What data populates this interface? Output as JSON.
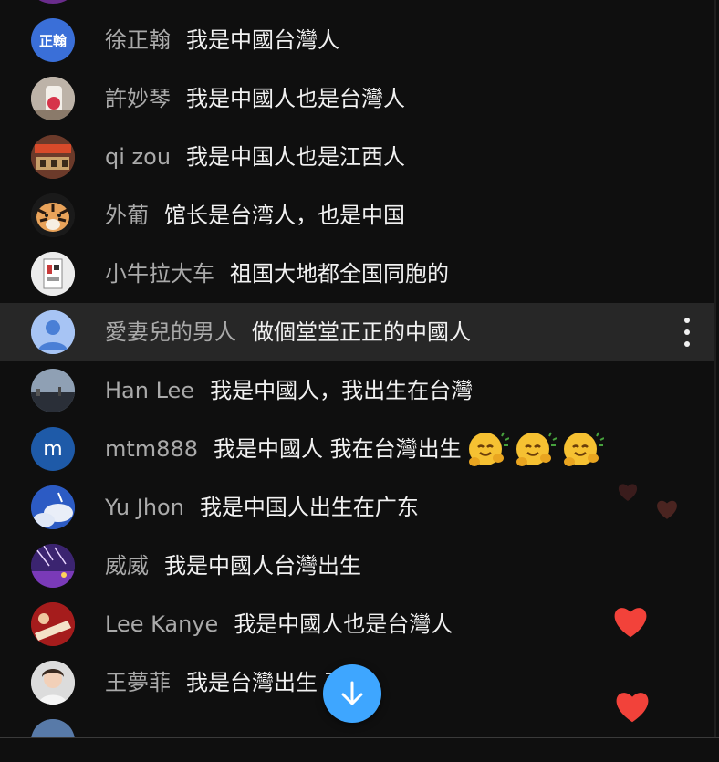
{
  "chat": {
    "messages": [
      {
        "author": "徐正翰",
        "text": "我是中國台灣人",
        "avatar_text": "正翰",
        "avatar_color": "#3a6fd8"
      },
      {
        "author": "許妙琴",
        "text": "我是中國人也是台灣人"
      },
      {
        "author": "qi zou",
        "text": "我是中国人也是江西人"
      },
      {
        "author": "外葡",
        "text": "馆长是台湾人，也是中国"
      },
      {
        "author": "小牛拉大车",
        "text": "祖国大地都全国同胞的"
      },
      {
        "author": "愛妻兒的男人",
        "text": "做個堂堂正正的中國人"
      },
      {
        "author": "Han Lee",
        "text": "我是中國人，我出生在台灣"
      },
      {
        "author": "mtm888",
        "text": "我是中國人 我在台灣出生",
        "avatar_text": "m",
        "avatar_color": "#1e5aa8",
        "emojis": [
          "hugging-face-emoji",
          "hugging-face-emoji",
          "hugging-face-emoji"
        ]
      },
      {
        "author": "Yu Jhon",
        "text": "我是中国人出生在广东"
      },
      {
        "author": "威威",
        "text": "我是中國人台灣出生"
      },
      {
        "author": "Lee Kanye",
        "text": "我是中國人也是台灣人"
      },
      {
        "author": "王夢菲",
        "text": "我是台灣出生 西人"
      },
      {
        "author": "",
        "text": ""
      }
    ],
    "highlighted_index": 5,
    "accent_color": "#3ea6ff"
  },
  "reactions": [
    "dark-heart-icon",
    "dark-heart-icon",
    "red-heart-icon",
    "red-heart-icon"
  ]
}
